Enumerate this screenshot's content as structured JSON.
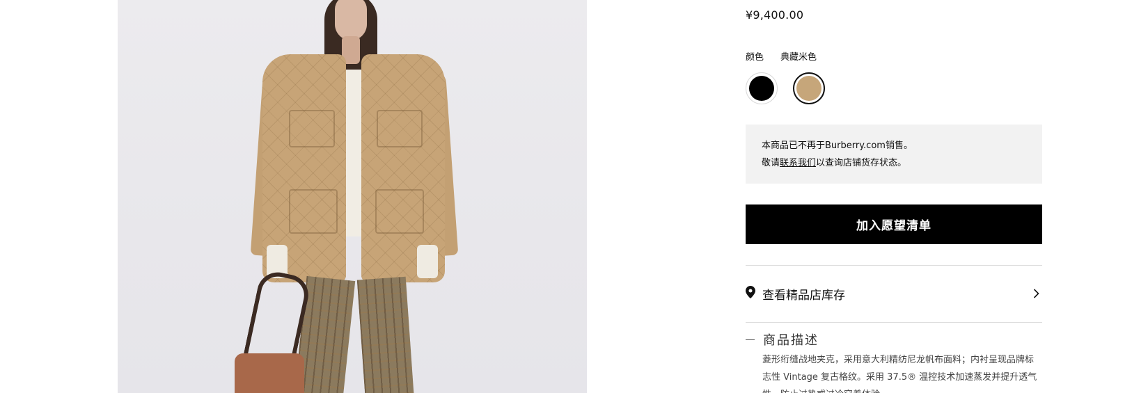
{
  "product": {
    "image_alt_icon": "product-photo-quilted-jacket",
    "price": "¥9,400.00",
    "color_label": "颜色",
    "color_selected": "典藏米色",
    "swatches": [
      {
        "name": "black",
        "color": "#000000",
        "selected": false
      },
      {
        "name": "archive-beige",
        "color": "#c6a67a",
        "selected": true
      }
    ],
    "notice": {
      "line1": "本商品已不再于Burberry.com销售。",
      "line2_prefix": "敬请",
      "line2_link": "联系我们",
      "line2_suffix": "以查询店铺货存状态。"
    },
    "wishlist_button": "加入愿望清单",
    "store_stock": {
      "icon": "map-pin-icon",
      "label": "查看精品店库存",
      "chevron_icon": "chevron-right-icon"
    },
    "description": {
      "heading": "商品描述",
      "text": "菱形绗缝战地夹克，采用意大利精纺尼龙帆布面料；内衬呈现品牌标志性 Vintage 复古格纹。采用 37.5® 温控技术加速蒸发并提升透气性，防止过热或过冷穿着体验。"
    }
  },
  "colors": {
    "button_bg": "#000000",
    "notice_bg": "#f2f2f2",
    "beige": "#c6a67a"
  }
}
